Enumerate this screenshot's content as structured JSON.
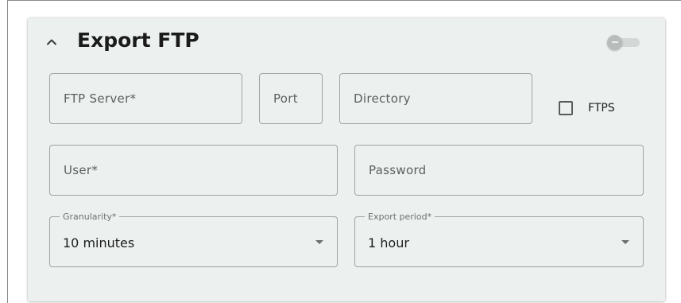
{
  "section": {
    "title": "Export FTP",
    "enabled": false,
    "collapse_icon": "chevron-up-icon"
  },
  "fields": {
    "ftp_server": {
      "placeholder": "FTP Server*",
      "value": ""
    },
    "port": {
      "placeholder": "Port",
      "value": ""
    },
    "directory": {
      "placeholder": "Directory",
      "value": ""
    },
    "user": {
      "placeholder": "User*",
      "value": ""
    },
    "password": {
      "placeholder": "Password",
      "value": ""
    }
  },
  "ftps": {
    "label": "FTPS",
    "checked": false
  },
  "granularity": {
    "label": "Granularity*",
    "value": "10 minutes"
  },
  "export_period": {
    "label": "Export period*",
    "value": "1 hour"
  },
  "colors": {
    "card_background": "#ecf1f0",
    "field_border": "#9ea4a3",
    "title_text": "#1b1b1b"
  }
}
